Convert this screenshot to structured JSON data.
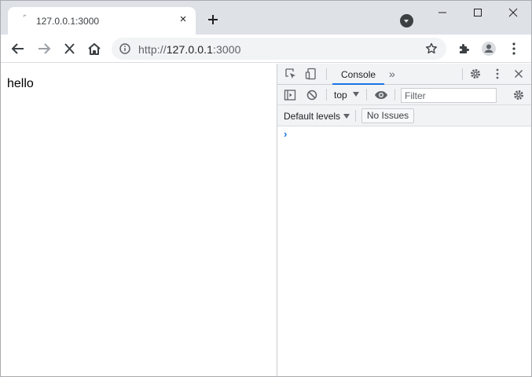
{
  "tab": {
    "title": "127.0.0.1:3000",
    "close_label": "×"
  },
  "toolbar": {
    "url_scheme": "http://",
    "url_host": "127.0.0.1",
    "url_port": ":3000"
  },
  "page": {
    "text": "hello"
  },
  "devtools": {
    "tabs": [
      {
        "label": "Console",
        "active": true
      }
    ],
    "more_tabs_label": "»",
    "context": "top",
    "filter_placeholder": "Filter",
    "levels_label": "Default levels",
    "issues_label": "No Issues",
    "prompt": "›"
  },
  "colors": {
    "tabstrip": "#dee1e6",
    "accent": "#1a73e8",
    "devtools_bar": "#f1f3f4"
  }
}
